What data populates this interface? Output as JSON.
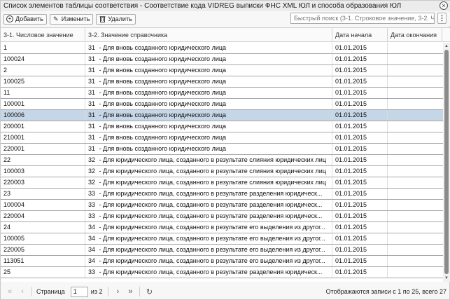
{
  "window": {
    "title": "Список элементов таблицы соответствия - Соответствие кода VIDREG выписки ФНС XML ЮЛ и способа образования ЮЛ",
    "close_glyph": "×"
  },
  "toolbar": {
    "add_label": "Добавить",
    "edit_label": "Изменить",
    "delete_label": "Удалить",
    "search_placeholder": "Быстрый поиск (3-1. Строковое значение, 3-2. Ч",
    "more_glyph": "⋮"
  },
  "grid": {
    "columns": [
      "3-1. Числовое значение",
      "3-2. Значение справочника",
      "Дата начала",
      "Дата окончания"
    ],
    "rows": [
      {
        "c1": "1",
        "code": "31",
        "desc": "Для вновь созданного юридического лица",
        "start": "01.01.2015",
        "end": ""
      },
      {
        "c1": "100024",
        "code": "31",
        "desc": "Для вновь созданного юридического лица",
        "start": "01.01.2015",
        "end": ""
      },
      {
        "c1": "2",
        "code": "31",
        "desc": "Для вновь созданного юридического лица",
        "start": "01.01.2015",
        "end": ""
      },
      {
        "c1": "100025",
        "code": "31",
        "desc": "Для вновь созданного юридического лица",
        "start": "01.01.2015",
        "end": ""
      },
      {
        "c1": "11",
        "code": "31",
        "desc": "Для вновь созданного юридического лица",
        "start": "01.01.2015",
        "end": ""
      },
      {
        "c1": "100001",
        "code": "31",
        "desc": "Для вновь созданного юридического лица",
        "start": "01.01.2015",
        "end": ""
      },
      {
        "c1": "100006",
        "code": "31",
        "desc": "Для вновь созданного юридического лица",
        "start": "01.01.2015",
        "end": "",
        "selected": true
      },
      {
        "c1": "200001",
        "code": "31",
        "desc": "Для вновь созданного юридического лица",
        "start": "01.01.2015",
        "end": ""
      },
      {
        "c1": "210001",
        "code": "31",
        "desc": "Для вновь созданного юридического лица",
        "start": "01.01.2015",
        "end": ""
      },
      {
        "c1": "220001",
        "code": "31",
        "desc": "Для вновь созданного юридического лица",
        "start": "01.01.2015",
        "end": ""
      },
      {
        "c1": "22",
        "code": "32",
        "desc": "Для юридического лица, созданного в результате слияния юридических лиц",
        "start": "01.01.2015",
        "end": ""
      },
      {
        "c1": "100003",
        "code": "32",
        "desc": "Для юридического лица, созданного в результате слияния юридических лиц",
        "start": "01.01.2015",
        "end": ""
      },
      {
        "c1": "220003",
        "code": "32",
        "desc": "Для юридического лица, созданного в результате слияния юридических лиц",
        "start": "01.01.2015",
        "end": ""
      },
      {
        "c1": "23",
        "code": "33",
        "desc": "Для юридического лица, созданного в результате разделения юридическ...",
        "start": "01.01.2015",
        "end": ""
      },
      {
        "c1": "100004",
        "code": "33",
        "desc": "Для юридического лица, созданного в результате разделения юридическ...",
        "start": "01.01.2015",
        "end": ""
      },
      {
        "c1": "220004",
        "code": "33",
        "desc": "Для юридического лица, созданного в результате разделения юридическ...",
        "start": "01.01.2015",
        "end": ""
      },
      {
        "c1": "24",
        "code": "34",
        "desc": "Для юридического лица, созданного в результате его выделения из другог...",
        "start": "01.01.2015",
        "end": ""
      },
      {
        "c1": "100005",
        "code": "34",
        "desc": "Для юридического лица, созданного в результате его выделения из другог...",
        "start": "01.01.2015",
        "end": ""
      },
      {
        "c1": "220005",
        "code": "34",
        "desc": "Для юридического лица, созданного в результате его выделения из другог...",
        "start": "01.01.2015",
        "end": ""
      },
      {
        "c1": "113051",
        "code": "34",
        "desc": "Для юридического лица, созданного в результате его выделения из другог...",
        "start": "01.01.2015",
        "end": ""
      },
      {
        "c1": "25",
        "code": "33",
        "desc": "Для юридического лица, созданного в результате разделения юридическ...",
        "start": "01.01.2015",
        "end": ""
      }
    ]
  },
  "pager": {
    "page_label": "Страница",
    "page_value": "1",
    "of_label": "из 2",
    "info": "Отображаются записи с 1 по 25, всего 27"
  }
}
